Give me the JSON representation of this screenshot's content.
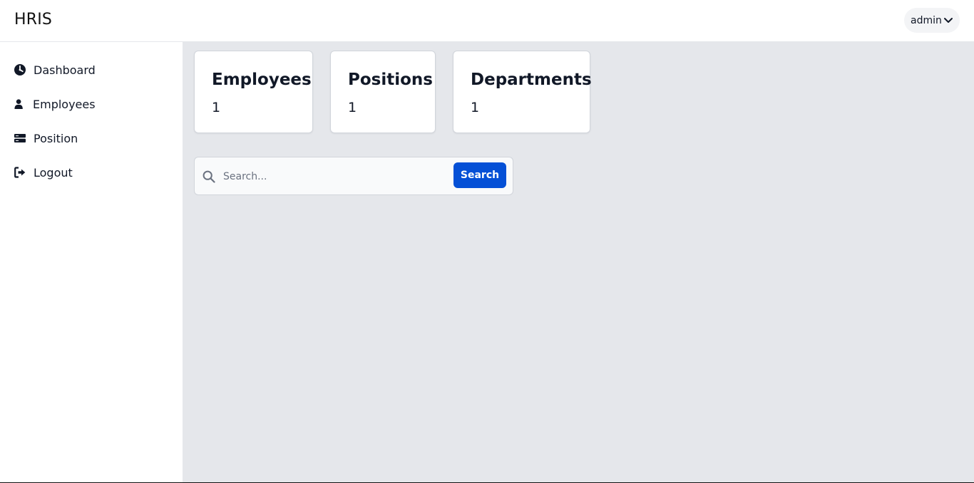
{
  "app": {
    "brand": "HRIS"
  },
  "user_menu": {
    "label": "admin",
    "icon": "chevron-down-icon"
  },
  "sidebar": {
    "items": [
      {
        "label": "Dashboard",
        "icon": "dashboard-gauge-icon"
      },
      {
        "label": "Employees",
        "icon": "user-icon"
      },
      {
        "label": "Position",
        "icon": "server-icon"
      },
      {
        "label": "Logout",
        "icon": "logout-icon"
      }
    ]
  },
  "stats": [
    {
      "title": "Employees",
      "count": "1"
    },
    {
      "title": "Positions",
      "count": "1"
    },
    {
      "title": "Departments",
      "count": "1"
    }
  ],
  "search": {
    "placeholder": "Search...",
    "value": "",
    "button_label": "Search",
    "icon": "search-icon"
  },
  "colors": {
    "accent": "#0550d6",
    "main_background": "#e5e7eb",
    "sidebar_background": "#ffffff",
    "card_background": "#ffffff"
  }
}
